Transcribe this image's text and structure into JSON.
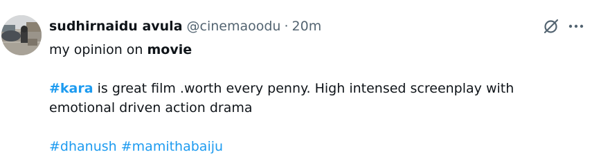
{
  "post": {
    "author": {
      "display_name": "sudhirnaidu avula",
      "handle": "@cinemaoodu"
    },
    "separator": "·",
    "timestamp": "20m",
    "text": {
      "line1_prefix": "my opinion on ",
      "line1_bold": "movie",
      "para2_hashtag": "#kara",
      "para2_text": " is great film .worth every penny. High intensed screenplay with",
      "para2_line2": "emotional driven action drama",
      "hashtags": [
        "#dhanush",
        "#mamithabaiju"
      ]
    },
    "actions": {
      "grok_icon": "slashed-circle-icon",
      "more_icon": "more-icon",
      "more_label": "···"
    },
    "colors": {
      "link": "#1d9bf0",
      "text": "#0f1419",
      "muted": "#536471"
    }
  }
}
